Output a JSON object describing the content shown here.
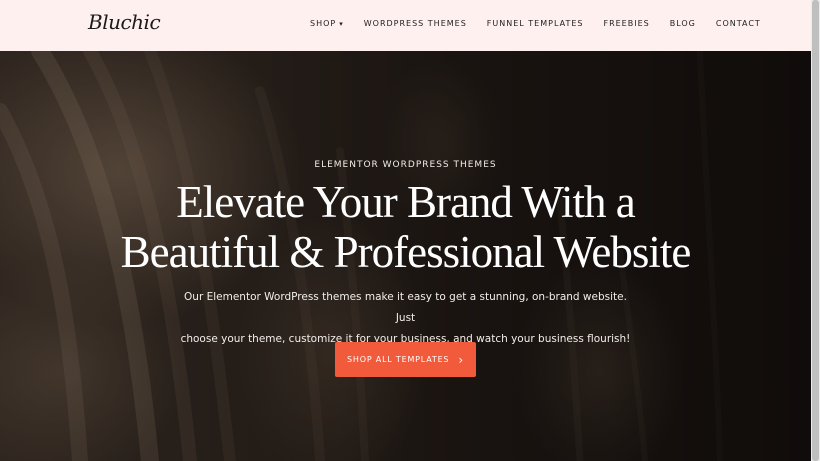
{
  "header": {
    "logo_text": "Bluchic",
    "nav": [
      {
        "label": "SHOP",
        "has_dropdown": true
      },
      {
        "label": "WORDPRESS THEMES"
      },
      {
        "label": "FUNNEL TEMPLATES"
      },
      {
        "label": "FREEBIES"
      },
      {
        "label": "BLOG"
      },
      {
        "label": "CONTACT"
      }
    ],
    "dropdown_icon": "caret-down-icon",
    "background": "#fdf0ee"
  },
  "hero": {
    "eyebrow": "ELEMENTOR WORDPRESS THEMES",
    "headline_line1": "Elevate Your Brand With a",
    "headline_line2": "Beautiful & Professional Website",
    "subtext_line1": "Our Elementor WordPress themes make it easy to get a stunning, on-brand website. Just",
    "subtext_line2": "choose your theme, customize it for your business, and watch your business flourish!",
    "cta_label": "SHOP ALL TEMPLATES",
    "cta_icon": "chevron-right-icon",
    "cta_color": "#f15a3a"
  },
  "glyphs": {
    "caret": "▾",
    "chevron": "›"
  }
}
